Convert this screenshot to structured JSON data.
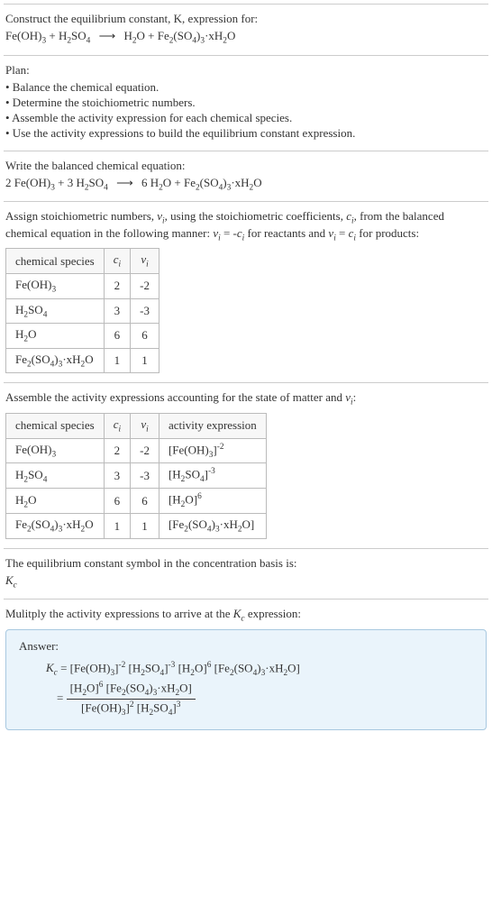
{
  "intro": {
    "line1": "Construct the equilibrium constant, K, expression for:",
    "reaction_lhs": "Fe(OH)₃ + H₂SO₄",
    "reaction_rhs": "H₂O + Fe₂(SO₄)₃·xH₂O"
  },
  "plan": {
    "heading": "Plan:",
    "items": [
      "• Balance the chemical equation.",
      "• Determine the stoichiometric numbers.",
      "• Assemble the activity expression for each chemical species.",
      "• Use the activity expressions to build the equilibrium constant expression."
    ]
  },
  "balanced": {
    "heading": "Write the balanced chemical equation:",
    "lhs_1_coef": "2",
    "lhs_2_coef": "3",
    "rhs_1_coef": "6"
  },
  "stoich": {
    "text1": "Assign stoichiometric numbers, νᵢ, using the stoichiometric coefficients, cᵢ, from the balanced chemical equation in the following manner: νᵢ = -cᵢ for reactants and νᵢ = cᵢ for products:",
    "headers": [
      "chemical species",
      "cᵢ",
      "νᵢ"
    ],
    "rows": [
      {
        "species": "Fe(OH)₃",
        "c": "2",
        "nu": "-2"
      },
      {
        "species": "H₂SO₄",
        "c": "3",
        "nu": "-3"
      },
      {
        "species": "H₂O",
        "c": "6",
        "nu": "6"
      },
      {
        "species": "Fe₂(SO₄)₃·xH₂O",
        "c": "1",
        "nu": "1"
      }
    ]
  },
  "activity": {
    "heading": "Assemble the activity expressions accounting for the state of matter and νᵢ:",
    "headers": [
      "chemical species",
      "cᵢ",
      "νᵢ",
      "activity expression"
    ],
    "rows": [
      {
        "species": "Fe(OH)₃",
        "c": "2",
        "nu": "-2",
        "expr_base": "[Fe(OH)₃]",
        "expr_pow": "-2"
      },
      {
        "species": "H₂SO₄",
        "c": "3",
        "nu": "-3",
        "expr_base": "[H₂SO₄]",
        "expr_pow": "-3"
      },
      {
        "species": "H₂O",
        "c": "6",
        "nu": "6",
        "expr_base": "[H₂O]",
        "expr_pow": "6"
      },
      {
        "species": "Fe₂(SO₄)₃·xH₂O",
        "c": "1",
        "nu": "1",
        "expr_base": "[Fe₂(SO₄)₃·xH₂O]",
        "expr_pow": ""
      }
    ]
  },
  "kc_symbol": {
    "line1": "The equilibrium constant symbol in the concentration basis is:",
    "symbol": "K_c"
  },
  "multiply": {
    "heading": "Mulitply the activity expressions to arrive at the K_c expression:"
  },
  "answer": {
    "label": "Answer:"
  }
}
